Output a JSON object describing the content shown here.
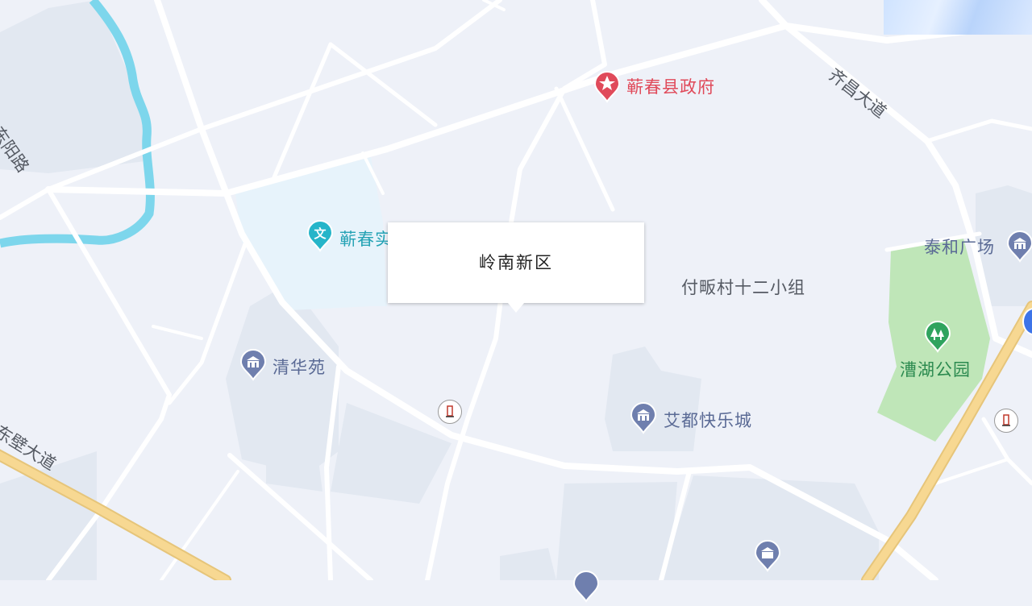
{
  "map": {
    "popup": {
      "title": "岭南新区"
    },
    "pois": [
      {
        "id": "gov",
        "label": "蕲春县政府",
        "icon": "star-pin-icon",
        "color": "#e04a5a"
      },
      {
        "id": "school",
        "label": "蕲春实",
        "icon": "culture-pin-icon",
        "color": "#26b5c9"
      },
      {
        "id": "village",
        "label": "付畈村十二小组",
        "icon": "",
        "color": "#555a63"
      },
      {
        "id": "plaza",
        "label": "泰和广场",
        "icon": "building-pin-icon",
        "color": "#5a6a95"
      },
      {
        "id": "park",
        "label": "漕湖公园",
        "icon": "park-pin-icon",
        "color": "#2b8a4f"
      },
      {
        "id": "qinghua",
        "label": "清华苑",
        "icon": "building-pin-icon",
        "color": "#5a6a95"
      },
      {
        "id": "aidou",
        "label": "艾都快乐城",
        "icon": "building-pin-icon",
        "color": "#5a6a95"
      }
    ],
    "roads": {
      "qichang": "齐昌大道",
      "dongbi": "东壁大道",
      "yang": "东阳路"
    }
  },
  "colors": {
    "background": "#eef1f8",
    "road": "#ffffff",
    "highway": "#f7d892",
    "river": "#7dd6ec",
    "park": "#bfe6b8",
    "block": "#e2e8f1"
  }
}
